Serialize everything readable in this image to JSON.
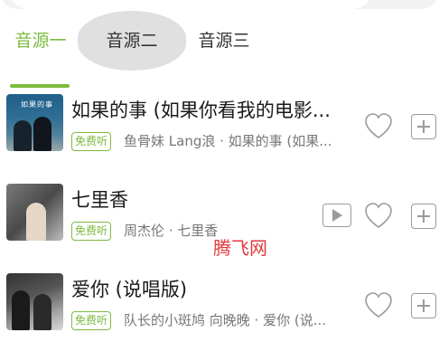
{
  "tabs": [
    {
      "label": "音源一"
    },
    {
      "label": "音源二"
    },
    {
      "label": "音源三"
    }
  ],
  "songs": [
    {
      "title": "如果的事 (如果你看我的电影...",
      "badge": "免费听",
      "meta": "鱼骨妹 Lang浪 · 如果的事 (如果...",
      "cover_text": "如果的事",
      "has_mv": false
    },
    {
      "title": "七里香",
      "badge": "免费听",
      "meta": "周杰伦 · 七里香",
      "has_mv": true
    },
    {
      "title": "爱你 (说唱版)",
      "badge": "免费听",
      "meta": "队长的小斑鸠 向晚晚 · 爱你 (说...",
      "has_mv": false
    }
  ],
  "watermark": "腾飞网",
  "colors": {
    "accent": "#7dbb3f",
    "watermark": "#e03a3a",
    "icon": "#9a9a9a"
  },
  "icons": [
    "heart-icon",
    "add-icon",
    "mv-play-icon"
  ]
}
